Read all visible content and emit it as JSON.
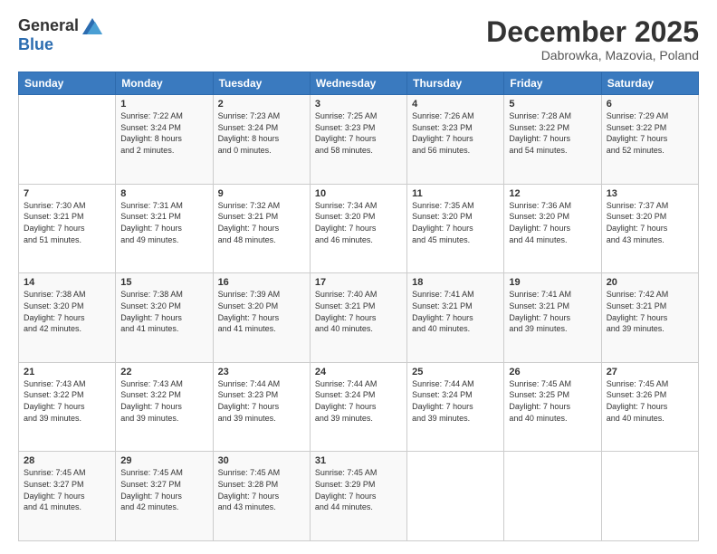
{
  "logo": {
    "general": "General",
    "blue": "Blue"
  },
  "title": "December 2025",
  "location": "Dabrowka, Mazovia, Poland",
  "weekdays": [
    "Sunday",
    "Monday",
    "Tuesday",
    "Wednesday",
    "Thursday",
    "Friday",
    "Saturday"
  ],
  "weeks": [
    [
      {
        "day": "",
        "info": ""
      },
      {
        "day": "1",
        "info": "Sunrise: 7:22 AM\nSunset: 3:24 PM\nDaylight: 8 hours\nand 2 minutes."
      },
      {
        "day": "2",
        "info": "Sunrise: 7:23 AM\nSunset: 3:24 PM\nDaylight: 8 hours\nand 0 minutes."
      },
      {
        "day": "3",
        "info": "Sunrise: 7:25 AM\nSunset: 3:23 PM\nDaylight: 7 hours\nand 58 minutes."
      },
      {
        "day": "4",
        "info": "Sunrise: 7:26 AM\nSunset: 3:23 PM\nDaylight: 7 hours\nand 56 minutes."
      },
      {
        "day": "5",
        "info": "Sunrise: 7:28 AM\nSunset: 3:22 PM\nDaylight: 7 hours\nand 54 minutes."
      },
      {
        "day": "6",
        "info": "Sunrise: 7:29 AM\nSunset: 3:22 PM\nDaylight: 7 hours\nand 52 minutes."
      }
    ],
    [
      {
        "day": "7",
        "info": "Sunrise: 7:30 AM\nSunset: 3:21 PM\nDaylight: 7 hours\nand 51 minutes."
      },
      {
        "day": "8",
        "info": "Sunrise: 7:31 AM\nSunset: 3:21 PM\nDaylight: 7 hours\nand 49 minutes."
      },
      {
        "day": "9",
        "info": "Sunrise: 7:32 AM\nSunset: 3:21 PM\nDaylight: 7 hours\nand 48 minutes."
      },
      {
        "day": "10",
        "info": "Sunrise: 7:34 AM\nSunset: 3:20 PM\nDaylight: 7 hours\nand 46 minutes."
      },
      {
        "day": "11",
        "info": "Sunrise: 7:35 AM\nSunset: 3:20 PM\nDaylight: 7 hours\nand 45 minutes."
      },
      {
        "day": "12",
        "info": "Sunrise: 7:36 AM\nSunset: 3:20 PM\nDaylight: 7 hours\nand 44 minutes."
      },
      {
        "day": "13",
        "info": "Sunrise: 7:37 AM\nSunset: 3:20 PM\nDaylight: 7 hours\nand 43 minutes."
      }
    ],
    [
      {
        "day": "14",
        "info": "Sunrise: 7:38 AM\nSunset: 3:20 PM\nDaylight: 7 hours\nand 42 minutes."
      },
      {
        "day": "15",
        "info": "Sunrise: 7:38 AM\nSunset: 3:20 PM\nDaylight: 7 hours\nand 41 minutes."
      },
      {
        "day": "16",
        "info": "Sunrise: 7:39 AM\nSunset: 3:20 PM\nDaylight: 7 hours\nand 41 minutes."
      },
      {
        "day": "17",
        "info": "Sunrise: 7:40 AM\nSunset: 3:21 PM\nDaylight: 7 hours\nand 40 minutes."
      },
      {
        "day": "18",
        "info": "Sunrise: 7:41 AM\nSunset: 3:21 PM\nDaylight: 7 hours\nand 40 minutes."
      },
      {
        "day": "19",
        "info": "Sunrise: 7:41 AM\nSunset: 3:21 PM\nDaylight: 7 hours\nand 39 minutes."
      },
      {
        "day": "20",
        "info": "Sunrise: 7:42 AM\nSunset: 3:21 PM\nDaylight: 7 hours\nand 39 minutes."
      }
    ],
    [
      {
        "day": "21",
        "info": "Sunrise: 7:43 AM\nSunset: 3:22 PM\nDaylight: 7 hours\nand 39 minutes."
      },
      {
        "day": "22",
        "info": "Sunrise: 7:43 AM\nSunset: 3:22 PM\nDaylight: 7 hours\nand 39 minutes."
      },
      {
        "day": "23",
        "info": "Sunrise: 7:44 AM\nSunset: 3:23 PM\nDaylight: 7 hours\nand 39 minutes."
      },
      {
        "day": "24",
        "info": "Sunrise: 7:44 AM\nSunset: 3:24 PM\nDaylight: 7 hours\nand 39 minutes."
      },
      {
        "day": "25",
        "info": "Sunrise: 7:44 AM\nSunset: 3:24 PM\nDaylight: 7 hours\nand 39 minutes."
      },
      {
        "day": "26",
        "info": "Sunrise: 7:45 AM\nSunset: 3:25 PM\nDaylight: 7 hours\nand 40 minutes."
      },
      {
        "day": "27",
        "info": "Sunrise: 7:45 AM\nSunset: 3:26 PM\nDaylight: 7 hours\nand 40 minutes."
      }
    ],
    [
      {
        "day": "28",
        "info": "Sunrise: 7:45 AM\nSunset: 3:27 PM\nDaylight: 7 hours\nand 41 minutes."
      },
      {
        "day": "29",
        "info": "Sunrise: 7:45 AM\nSunset: 3:27 PM\nDaylight: 7 hours\nand 42 minutes."
      },
      {
        "day": "30",
        "info": "Sunrise: 7:45 AM\nSunset: 3:28 PM\nDaylight: 7 hours\nand 43 minutes."
      },
      {
        "day": "31",
        "info": "Sunrise: 7:45 AM\nSunset: 3:29 PM\nDaylight: 7 hours\nand 44 minutes."
      },
      {
        "day": "",
        "info": ""
      },
      {
        "day": "",
        "info": ""
      },
      {
        "day": "",
        "info": ""
      }
    ]
  ]
}
